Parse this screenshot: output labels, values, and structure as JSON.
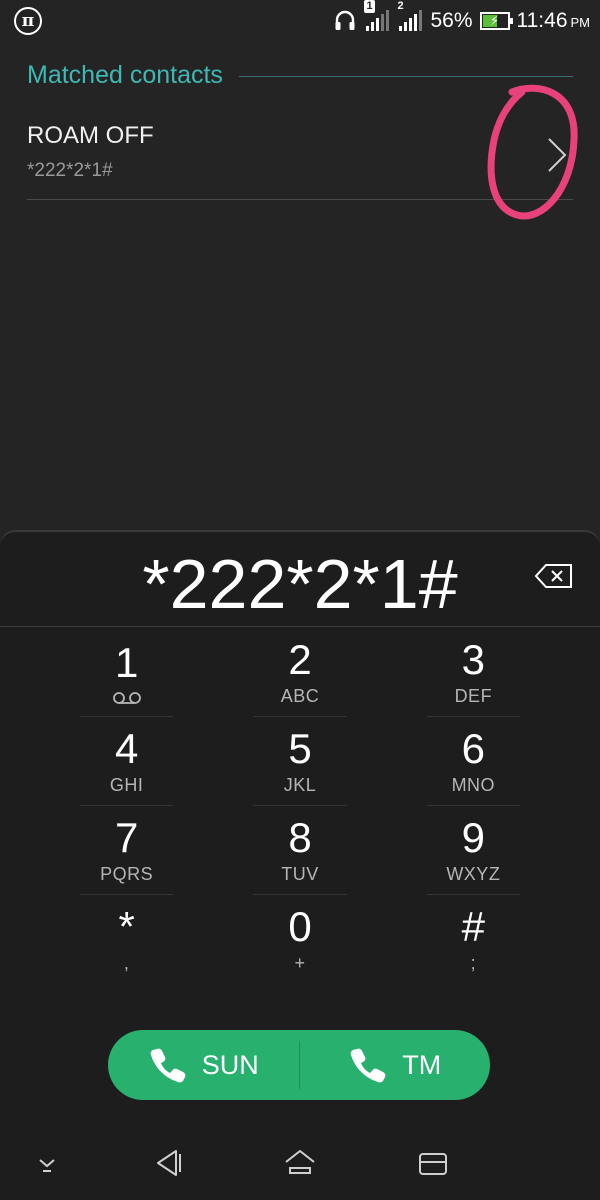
{
  "status_bar": {
    "sim1": "1",
    "sim2": "2",
    "battery": "56%",
    "time": "11:46",
    "ampm": "PM"
  },
  "matched": {
    "title": "Matched contacts",
    "contact_name": "ROAM OFF",
    "contact_number": "*222*2*1#"
  },
  "dialer": {
    "display": "*222*2*1#",
    "keys": [
      {
        "digit": "1",
        "letters": ""
      },
      {
        "digit": "2",
        "letters": "ABC"
      },
      {
        "digit": "3",
        "letters": "DEF"
      },
      {
        "digit": "4",
        "letters": "GHI"
      },
      {
        "digit": "5",
        "letters": "JKL"
      },
      {
        "digit": "6",
        "letters": "MNO"
      },
      {
        "digit": "7",
        "letters": "PQRS"
      },
      {
        "digit": "8",
        "letters": "TUV"
      },
      {
        "digit": "9",
        "letters": "WXYZ"
      },
      {
        "digit": "*",
        "letters": ","
      },
      {
        "digit": "0",
        "letters": "+"
      },
      {
        "digit": "#",
        "letters": ";"
      }
    ],
    "call_sim1": "SUN",
    "call_sim2": "TM"
  },
  "colors": {
    "accent_teal": "#3fb8b4",
    "call_green": "#27b06e",
    "annotation_pink": "#e8417b",
    "battery_green": "#5bbf3a"
  },
  "icons": [
    "pi-icon",
    "headphones-icon",
    "signal-icon",
    "battery-icon",
    "chevron-right-icon",
    "backspace-icon",
    "voicemail-icon",
    "phone-icon",
    "nav-down-icon",
    "nav-back-icon",
    "nav-home-icon",
    "nav-recents-icon"
  ]
}
